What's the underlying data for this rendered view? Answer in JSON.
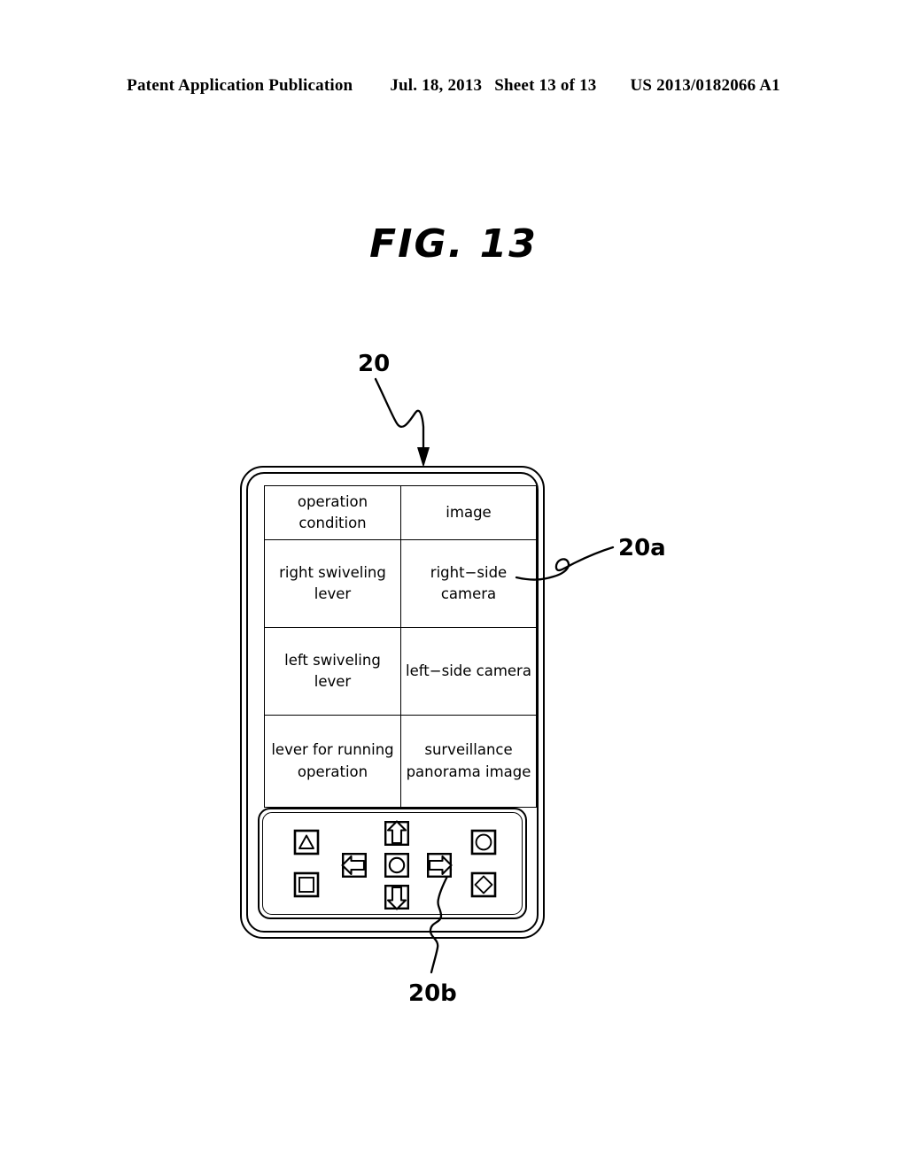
{
  "header": {
    "publication": "Patent Application Publication",
    "date": "Jul. 18, 2013",
    "sheet": "Sheet 13 of 13",
    "patent_number": "US 2013/0182066 A1"
  },
  "figure": {
    "title": "FIG. 13",
    "reference_numerals": {
      "device": "20",
      "display_area": "20a",
      "button_area": "20b"
    }
  },
  "device": {
    "table": {
      "columns": [
        "operation condition",
        "image"
      ],
      "rows": [
        {
          "operation_condition": "right swiveling lever",
          "image": "right−side camera"
        },
        {
          "operation_condition": "left swiveling lever",
          "image": "left−side camera"
        },
        {
          "operation_condition": "lever for running operation",
          "image": "surveillance panorama image"
        }
      ]
    },
    "buttons": [
      {
        "name": "triangle-button",
        "glyph": "triangle",
        "position": "left-top"
      },
      {
        "name": "square-button",
        "glyph": "square",
        "position": "left-bottom"
      },
      {
        "name": "up-arrow-button",
        "glyph": "arrow-up",
        "position": "center-top"
      },
      {
        "name": "left-arrow-button",
        "glyph": "arrow-left",
        "position": "center-left"
      },
      {
        "name": "enter-button",
        "glyph": "circle",
        "position": "center-center"
      },
      {
        "name": "right-arrow-button",
        "glyph": "arrow-right",
        "position": "center-right"
      },
      {
        "name": "down-arrow-button",
        "glyph": "arrow-down",
        "position": "center-bottom"
      },
      {
        "name": "circle-button",
        "glyph": "circle",
        "position": "right-top"
      },
      {
        "name": "diamond-button",
        "glyph": "diamond",
        "position": "right-bottom"
      }
    ]
  },
  "colors": {
    "ink": "#000000",
    "paper": "#ffffff"
  }
}
